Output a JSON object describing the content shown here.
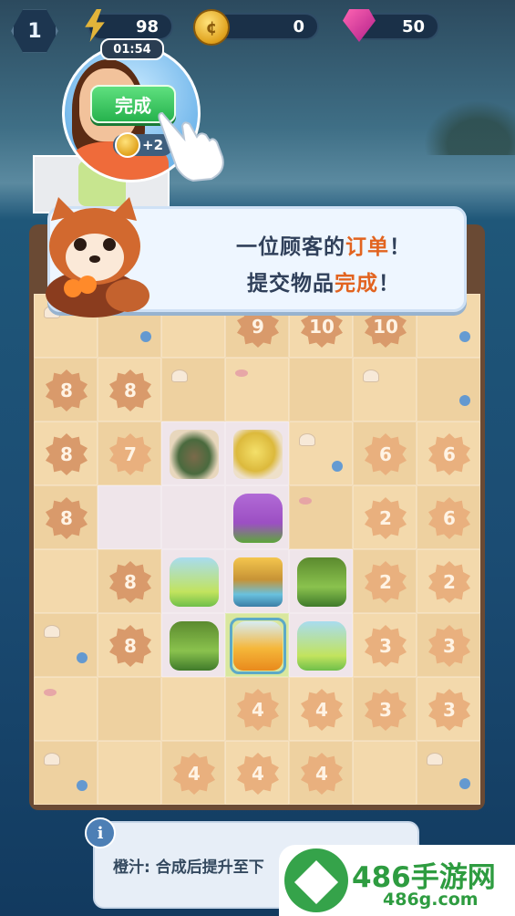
{
  "hud": {
    "level": "1",
    "energy": "98",
    "coins": "0",
    "gems": "50"
  },
  "customer": {
    "timer": "01:54",
    "done_button": "完成",
    "reward": "+2"
  },
  "dialog": {
    "line1_a": "一位顾客的",
    "line1_b": "订单",
    "line1_c": "！",
    "line2_a": "提交物品",
    "line2_b": "完成",
    "line2_c": "！"
  },
  "tip": {
    "text": "橙汁: 合成后提升至下"
  },
  "watermark": {
    "brand": "486手游网",
    "domain": "486g.com"
  },
  "board": {
    "rows": [
      [
        "bg",
        "bg",
        "bg",
        "9",
        "10",
        "10",
        "bg"
      ],
      [
        "8",
        "8",
        "bg",
        "bg",
        "bg",
        "bg",
        "bg"
      ],
      [
        "8",
        "7",
        "fish",
        "duck",
        "bg",
        "6",
        "6"
      ],
      [
        "8",
        "open",
        "open",
        "cocktail",
        "bg",
        "2",
        "6"
      ],
      [
        "bg",
        "8",
        "lemonade",
        "chair",
        "green",
        "2",
        "2"
      ],
      [
        "bg",
        "8",
        "green",
        "orange",
        "lemonade",
        "3",
        "3"
      ],
      [
        "bg",
        "bg",
        "bg",
        "4",
        "4",
        "3",
        "3"
      ],
      [
        "bg",
        "bg",
        "4",
        "4",
        "4",
        "bg",
        "bg"
      ]
    ]
  }
}
